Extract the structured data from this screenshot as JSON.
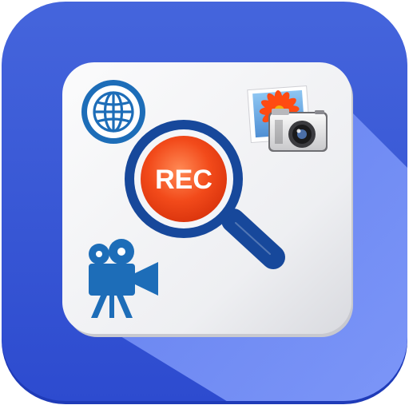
{
  "app_icon": {
    "badge_label": "REC",
    "icons": [
      "globe-icon",
      "photo-icon",
      "camera-icon",
      "magnifier-icon",
      "video-camera-icon"
    ]
  },
  "colors": {
    "background_blue": "#3d5fd8",
    "background_blue_dark": "#2e4ccc",
    "shadow_blue": "#6f8cf5",
    "card_light": "#f4f4f6",
    "card_shade": "#dcdde2",
    "accent_navy": "#17489b",
    "rec_orange": "#f04418",
    "rec_orange_light": "#ff7a4a",
    "icon_blue": "#1d6db8"
  }
}
